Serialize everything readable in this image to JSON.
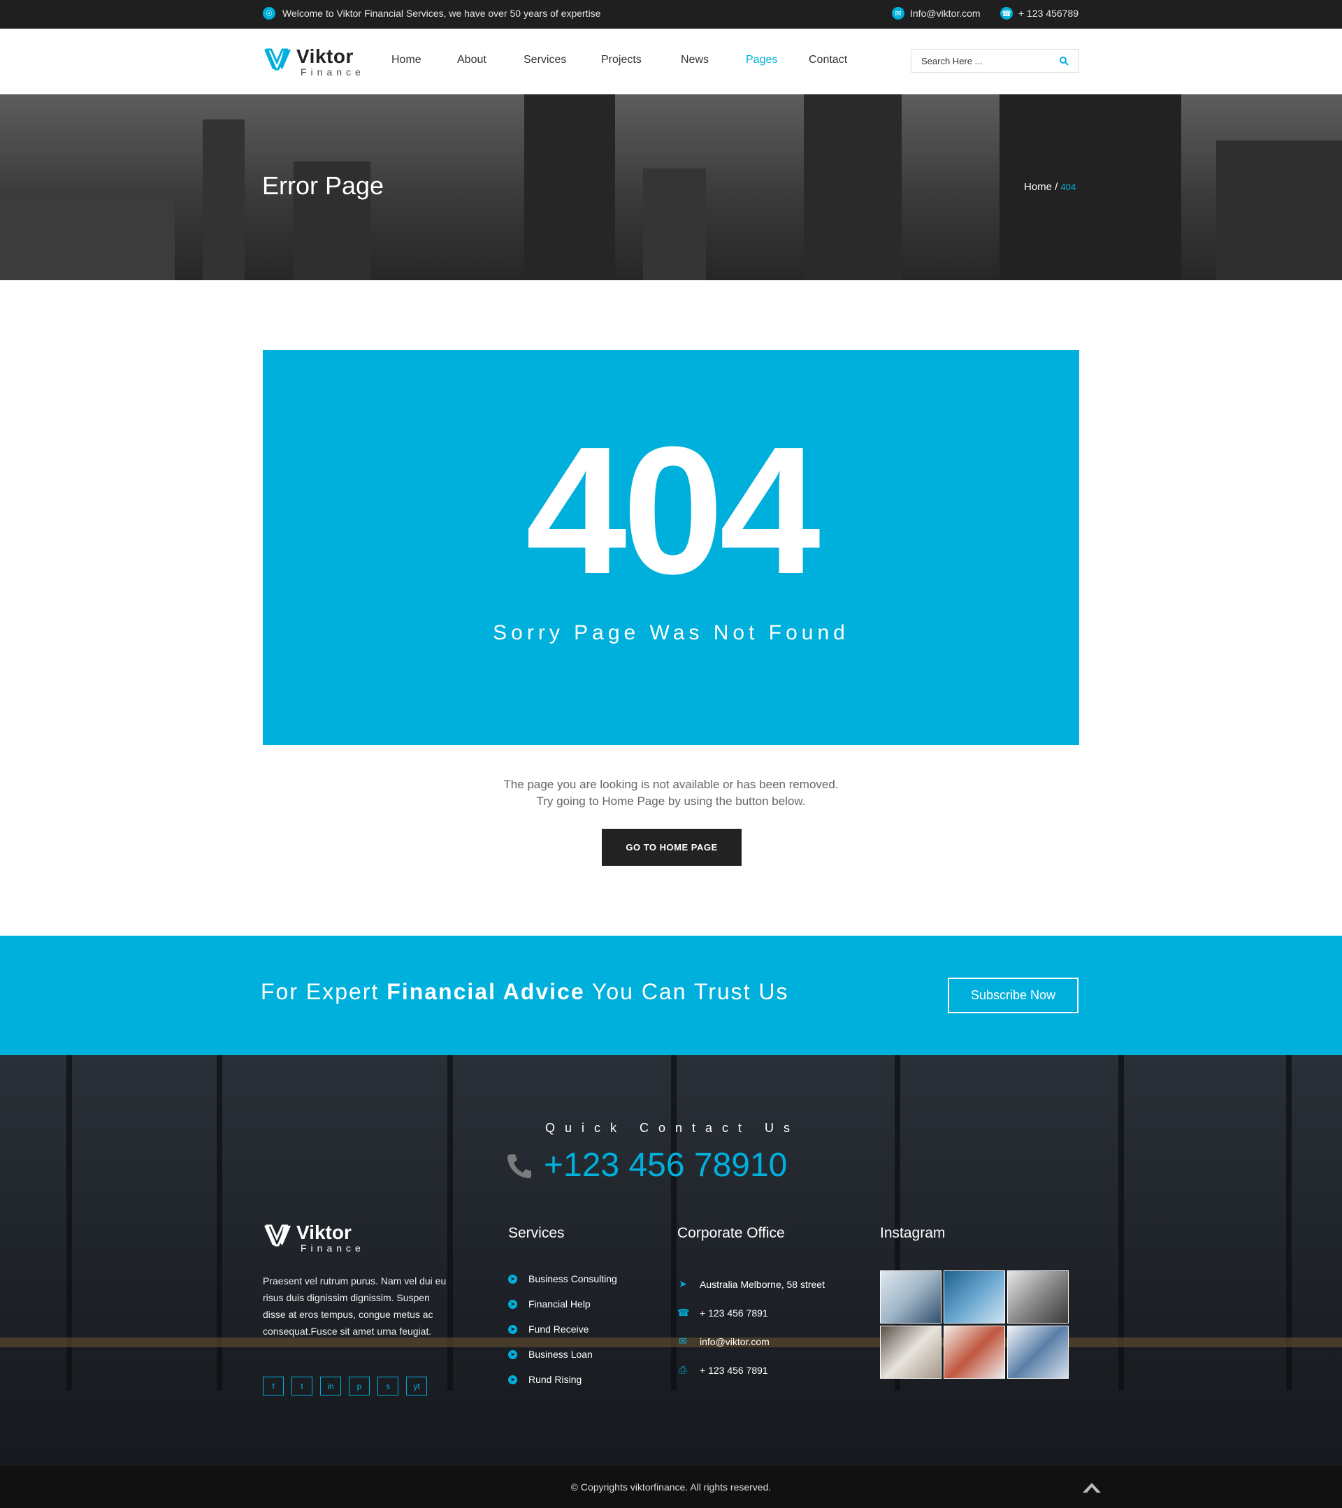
{
  "topbar": {
    "welcome": "Welcome to Viktor  Financial Services, we have over 50 years of expertise",
    "email": "Info@viktor.com",
    "phone": "+ 123 456789"
  },
  "header": {
    "logo_name": "Viktor",
    "logo_sub": "Finance",
    "nav": [
      "Home",
      "About",
      "Services",
      "Projects",
      "News",
      "Pages",
      "Contact"
    ],
    "active_nav": "Pages",
    "search_placeholder": "Search Here ..."
  },
  "banner": {
    "title": "Error Page",
    "crumb_home": "Home /",
    "crumb_current": "404"
  },
  "error": {
    "code": "404",
    "subtitle": "Sorry Page Was Not Found",
    "msg_line1": "The page you are looking is not available or has been removed.",
    "msg_line2": "Try going to Home Page by using the button below.",
    "button": "GO TO HOME PAGE"
  },
  "cta": {
    "text_pre": "For Expert ",
    "text_bold": "Financial Advice",
    "text_post": " You Can Trust Us",
    "button": "Subscribe Now"
  },
  "footer": {
    "quick_contact_title": "Quick Contact Us",
    "quick_contact_phone": "+123 456 78910",
    "logo_name": "Viktor",
    "logo_sub": "Finance",
    "description": "Praesent vel rutrum purus. Nam vel dui eu risus duis dignissim dignissim. Suspen disse at eros tempus, congue metus ac consequat.Fusce sit amet urna feugiat.",
    "social": [
      "f",
      "t",
      "in",
      "p",
      "s",
      "yt"
    ],
    "services_title": "Services",
    "services": [
      "Business Consulting",
      "Financial Help",
      "Fund Receive",
      "Business Loan",
      "Rund Rising"
    ],
    "office_title": "Corporate Office",
    "office": [
      {
        "icon": "send-icon",
        "text": "Australia Melborne, 58 street"
      },
      {
        "icon": "phone-icon",
        "text": "+ 123 456 7891"
      },
      {
        "icon": "mail-icon",
        "text": "info@viktor.com"
      },
      {
        "icon": "fax-icon",
        "text": "+ 123 456 7891"
      }
    ],
    "instagram_title": "Instagram",
    "copyright": "© Copyrights viktorfinance. All rights reserved."
  },
  "colors": {
    "accent": "#00b0dc",
    "dark": "#1f1f1f"
  }
}
